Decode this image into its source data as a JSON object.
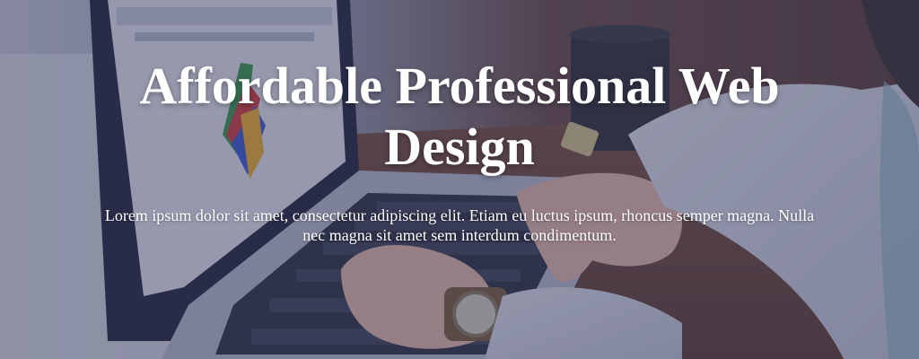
{
  "hero": {
    "title": "Affordable Professional Web Design",
    "subtitle": "Lorem ipsum dolor sit amet, consectetur adipiscing elit. Etiam eu luctus ipsum, rhoncus semper magna. Nulla nec magna sit amet sem interdum condimentum.",
    "background_image": "photo-laptop-desk",
    "overlay_color": "#34385c"
  }
}
